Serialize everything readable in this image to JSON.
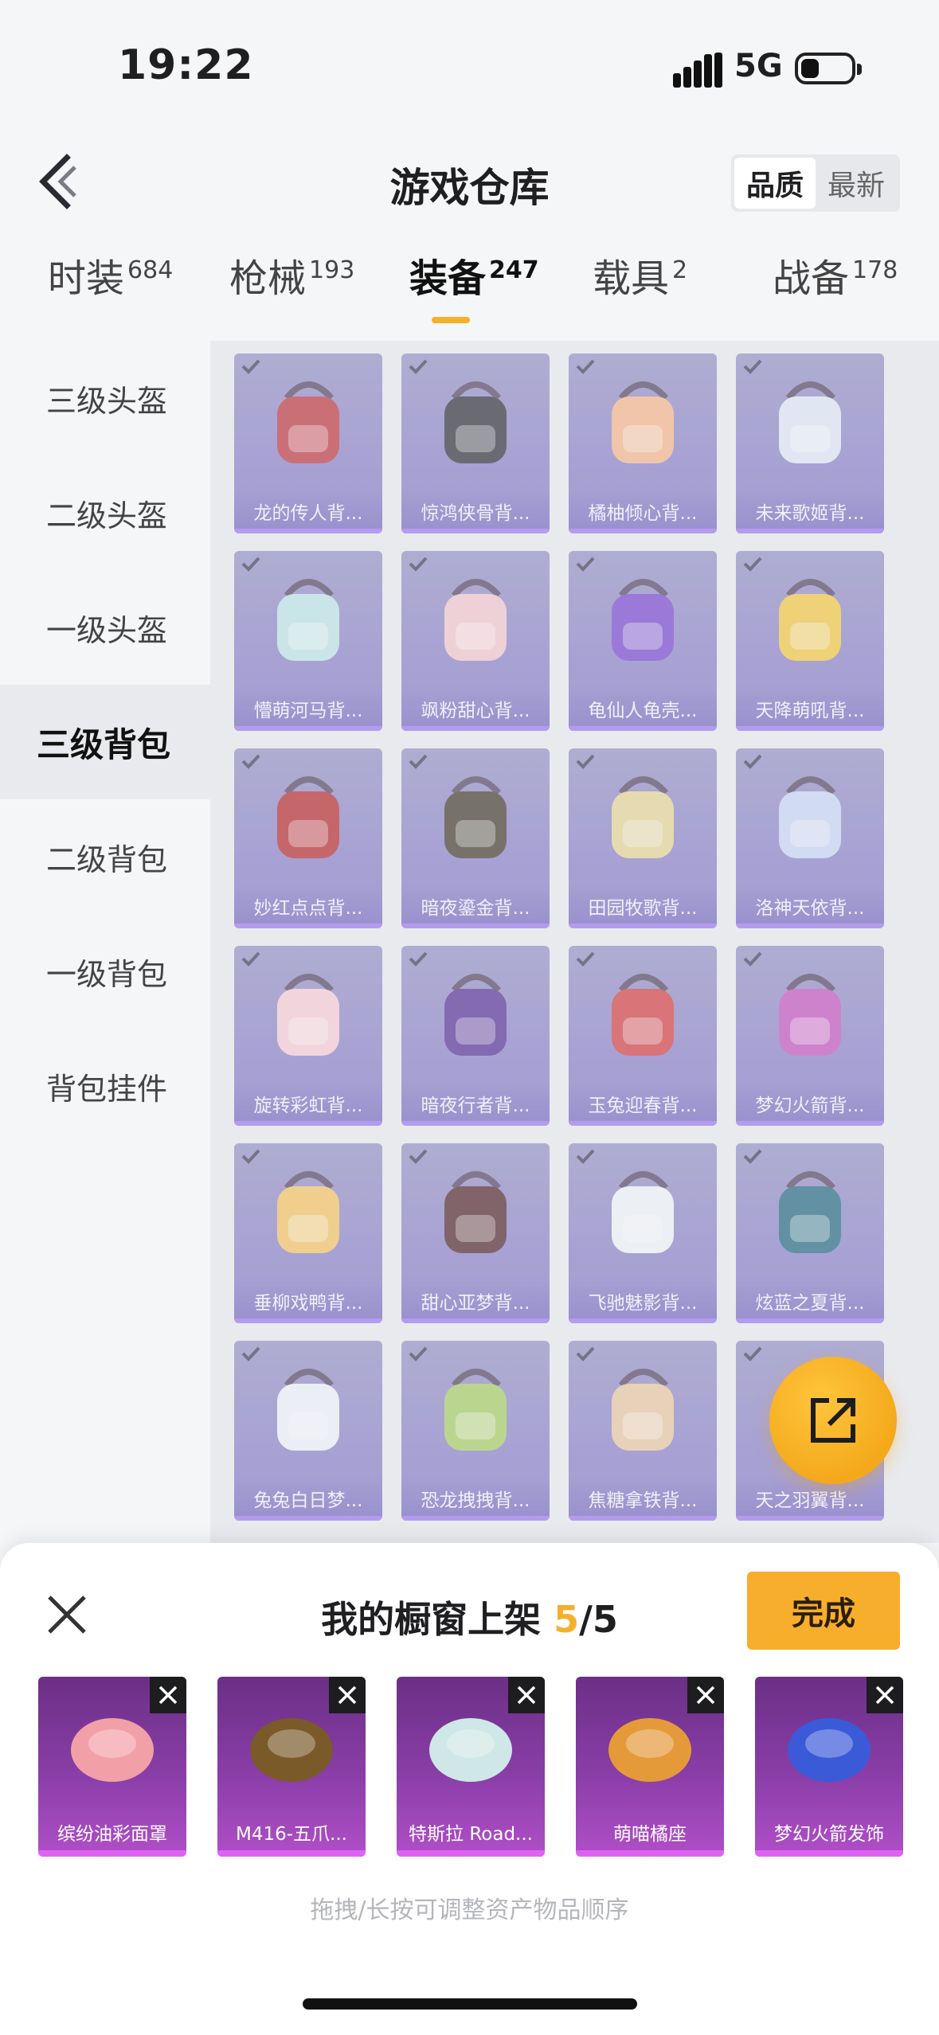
{
  "status": {
    "time": "19:22",
    "network": "5G",
    "battery_level": 0.3
  },
  "header": {
    "title": "游戏仓库",
    "sort": [
      "品质",
      "最新"
    ],
    "sort_active": 0
  },
  "categories": [
    {
      "label": "时装",
      "count": "684"
    },
    {
      "label": "枪械",
      "count": "193"
    },
    {
      "label": "装备",
      "count": "247"
    },
    {
      "label": "载具",
      "count": "2"
    },
    {
      "label": "战备",
      "count": "178"
    }
  ],
  "categories_active": 2,
  "sidebar": {
    "items": [
      "三级头盔",
      "二级头盔",
      "一级头盔",
      "三级背包",
      "二级背包",
      "一级背包",
      "背包挂件"
    ],
    "active": 3
  },
  "grid": {
    "items": [
      {
        "name": "龙的传人背...",
        "color": "#c0404a"
      },
      {
        "name": "惊鸿侠骨背...",
        "color": "#3a3a44"
      },
      {
        "name": "橘柚倾心背...",
        "color": "#f3b890"
      },
      {
        "name": "未来歌姬背...",
        "color": "#dfe6f4"
      },
      {
        "name": "懵萌河马背...",
        "color": "#bfe4e6"
      },
      {
        "name": "飒粉甜心背...",
        "color": "#f1c7cf"
      },
      {
        "name": "龟仙人龟壳...",
        "color": "#7c4fd0"
      },
      {
        "name": "天降萌吼背...",
        "color": "#f2c84a"
      },
      {
        "name": "妙红点点背...",
        "color": "#b8343a"
      },
      {
        "name": "暗夜鎏金背...",
        "color": "#4a4438"
      },
      {
        "name": "田园牧歌背...",
        "color": "#e5d59a"
      },
      {
        "name": "洛神天依背...",
        "color": "#c9d6f3"
      },
      {
        "name": "旋转彩虹背...",
        "color": "#f6cdd6"
      },
      {
        "name": "暗夜行者背...",
        "color": "#5c3a9a"
      },
      {
        "name": "玉兔迎春背...",
        "color": "#d3474c"
      },
      {
        "name": "梦幻火箭背...",
        "color": "#c55bc0"
      },
      {
        "name": "垂柳戏鸭背...",
        "color": "#f3c66a"
      },
      {
        "name": "甜心亚梦背...",
        "color": "#5a3038"
      },
      {
        "name": "飞驰魅影背...",
        "color": "#eef1f5"
      },
      {
        "name": "炫蓝之夏背...",
        "color": "#2d6f86"
      },
      {
        "name": "兔兔白日梦...",
        "color": "#eef0f8"
      },
      {
        "name": "恐龙拽拽背...",
        "color": "#a9cf6a"
      },
      {
        "name": "焦糖拿铁背...",
        "color": "#e8c8a6"
      },
      {
        "name": "天之羽翼背...",
        "color": "#d6c88f"
      }
    ]
  },
  "shelf": {
    "title": "我的橱窗上架",
    "current": "5",
    "total": "/5",
    "done_label": "完成",
    "hint": "拖拽/长按可调整资产物品顺序",
    "items": [
      {
        "name": "缤纷油彩面罩",
        "color": "#f2a0a8"
      },
      {
        "name": "M416-五爪...",
        "color": "#7a5a28"
      },
      {
        "name": "特斯拉 Road...",
        "color": "#cfe7e6"
      },
      {
        "name": "萌喵橘座",
        "color": "#e59a3a"
      },
      {
        "name": "梦幻火箭发饰",
        "color": "#3a5ad8"
      }
    ]
  }
}
